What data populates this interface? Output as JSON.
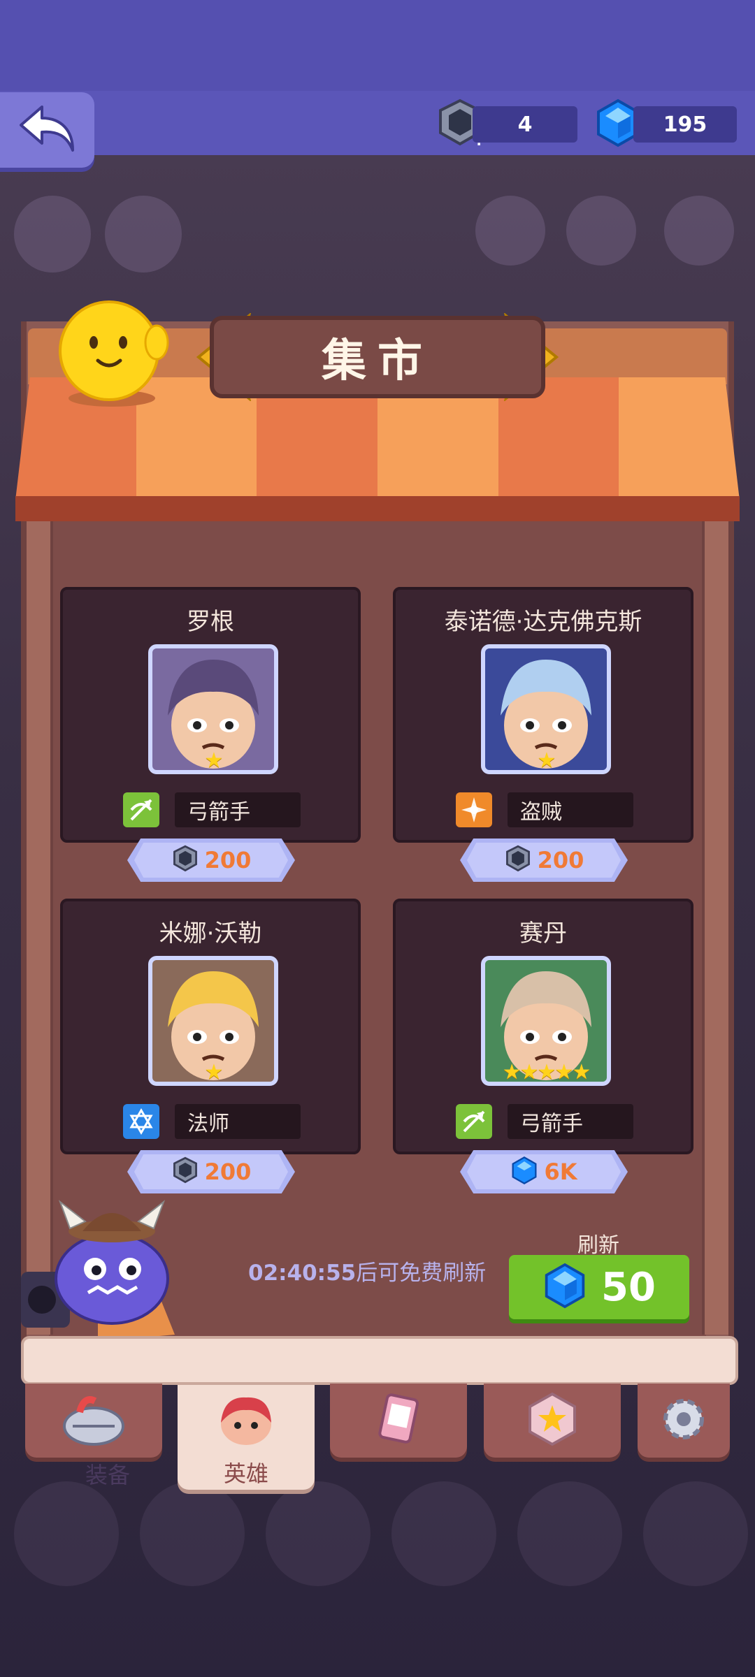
{
  "header": {
    "back_icon": "back-arrow-icon",
    "ticket_count": "4",
    "ticket_icon": "hero-ticket-icon",
    "gem_count": "195",
    "gem_icon": "blue-gem-icon"
  },
  "shop": {
    "title": "集市",
    "cards": [
      {
        "name": "罗根",
        "stars": "★",
        "class_label": "弓箭手",
        "class_icon": "archer-class-icon",
        "class_color": "#7cc23a",
        "price": "200",
        "price_icon": "hero-ticket-icon",
        "portrait_color": "#7a6aa0",
        "hair": "#5a4a7a"
      },
      {
        "name": "泰诺德·达克佛克斯",
        "stars": "★",
        "class_label": "盗贼",
        "class_icon": "rogue-class-icon",
        "class_color": "#f08a2a",
        "price": "200",
        "price_icon": "hero-ticket-icon",
        "portrait_color": "#3b4a9a",
        "hair": "#b0cff0"
      },
      {
        "name": "米娜·沃勒",
        "stars": "★",
        "class_label": "法师",
        "class_icon": "mage-class-icon",
        "class_color": "#2a86e8",
        "price": "200",
        "price_icon": "hero-ticket-icon",
        "portrait_color": "#8a6a5a",
        "hair": "#f4c64a"
      },
      {
        "name": "赛丹",
        "stars": "★★★★★",
        "class_label": "弓箭手",
        "class_icon": "archer-class-icon",
        "class_color": "#7cc23a",
        "price": "6K",
        "price_icon": "blue-gem-icon",
        "portrait_color": "#4a8a5a",
        "hair": "#d8c0a8"
      }
    ],
    "refresh": {
      "timer": "02:40:55",
      "timer_suffix": "后可免费刷新",
      "label": "刷新",
      "cost": "50"
    }
  },
  "tabs": [
    {
      "label": "装备",
      "icon": "helmet-icon",
      "active": false
    },
    {
      "label": "英雄",
      "icon": "hero-face-icon",
      "active": true
    },
    {
      "label": "",
      "icon": "card-icon",
      "active": false
    },
    {
      "label": "",
      "icon": "star-badge-icon",
      "active": false
    },
    {
      "label": "",
      "icon": "gear-icon",
      "active": false
    }
  ],
  "colors": {
    "accent_price": "#f07a36",
    "refresh_button": "#73c22a",
    "header": "#5550b0"
  }
}
